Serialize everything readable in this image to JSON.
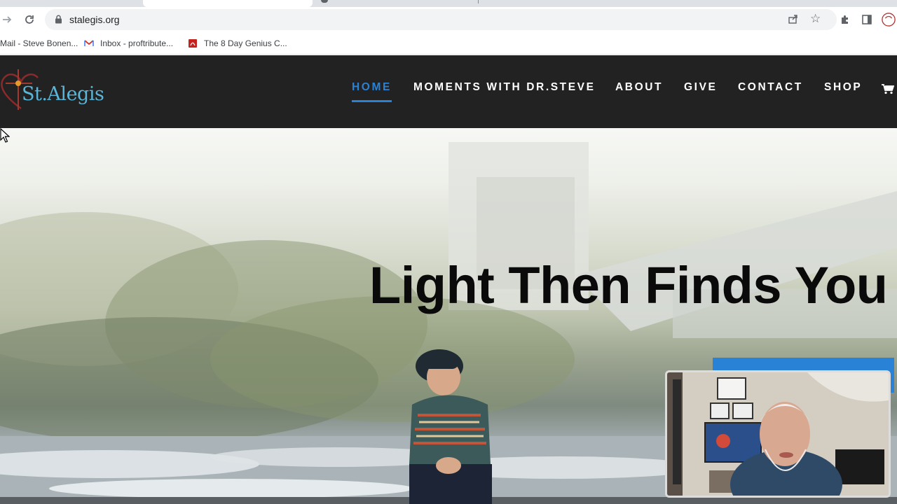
{
  "browser": {
    "url": "stalegis.org",
    "bookmarks": [
      {
        "label": "Mail - Steve Bonen...",
        "icon": "mail-icon"
      },
      {
        "label": "Inbox - proftribute...",
        "icon": "gmail-icon"
      },
      {
        "label": "The 8 Day Genius C...",
        "icon": "pdf-icon"
      }
    ]
  },
  "site": {
    "logo_text": "St.Alegis",
    "nav": [
      {
        "label": "HOME",
        "active": true
      },
      {
        "label": "MOMENTS WITH DR.STEVE"
      },
      {
        "label": "ABOUT"
      },
      {
        "label": "GIVE"
      },
      {
        "label": "CONTACT"
      },
      {
        "label": "SHOP"
      }
    ],
    "colors": {
      "header_bg": "#222222",
      "accent": "#2a82d6",
      "logo": "#5ab6d8"
    }
  },
  "hero": {
    "headline": "Light Then Finds You"
  }
}
